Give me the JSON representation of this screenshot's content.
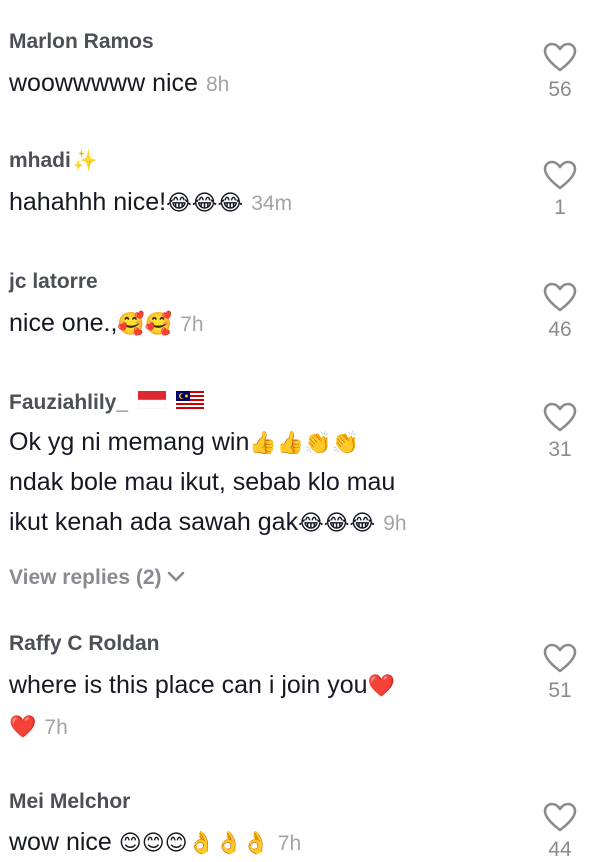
{
  "comments": [
    {
      "username": "Marlon Ramos",
      "lines": [
        "woowwwww nice"
      ],
      "emojis": "",
      "time": "8h",
      "likes": "56"
    },
    {
      "username": "mhadi",
      "username_decoration": "✨",
      "lines": [
        "hahahhh nice!"
      ],
      "emojis": "😂😂😂",
      "time": "34m",
      "likes": "1"
    },
    {
      "username": "jc latorre",
      "lines": [
        "nice one.,"
      ],
      "emojis": "🥰🥰",
      "time": "7h",
      "likes": "46"
    },
    {
      "username": "Fauziahlily_",
      "lines": [
        "Ok yg ni memang win",
        "ndak bole mau ikut, sebab klo mau",
        "ikut kenah ada sawah gak"
      ],
      "line1_emojis": "👍👍👏👏",
      "emojis": "😂😂😂",
      "time": "9h",
      "likes": "31",
      "view_replies": "View replies (2)"
    },
    {
      "username": "Raffy C Roldan",
      "lines": [
        "where is this place can i join you"
      ],
      "line1_emojis": "❤️",
      "line2_emojis": "❤️",
      "time": "7h",
      "likes": "51"
    },
    {
      "username": "Mei Melchor",
      "lines": [
        "wow nice"
      ],
      "emojis": "😊😊😊👌👌👌",
      "time": "7h",
      "likes": "44"
    }
  ],
  "colors": {
    "username": "#4d4f57",
    "text": "#161823",
    "muted": "#a3a4a8",
    "heart_outline": "#8a8b91",
    "red_heart": "#e0262f"
  },
  "icons": {
    "like": "heart-outline-icon",
    "expand": "chevron-down-icon"
  }
}
